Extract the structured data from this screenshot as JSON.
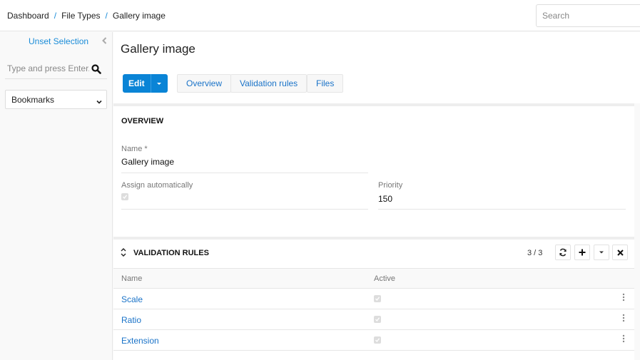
{
  "header": {
    "breadcrumb": [
      "Dashboard",
      "File Types",
      "Gallery image"
    ],
    "separator": "/",
    "search_placeholder": "Search"
  },
  "sidebar": {
    "unset_selection": "Unset Selection",
    "search_placeholder": "Type and press Enter...",
    "bookmarks_label": "Bookmarks"
  },
  "page": {
    "title": "Gallery image",
    "edit_label": "Edit",
    "tabs": [
      "Overview",
      "Validation rules",
      "Files"
    ]
  },
  "overview": {
    "title": "OVERVIEW",
    "name_label": "Name *",
    "name_value": "Gallery image",
    "assign_label": "Assign automatically",
    "assign_checked": true,
    "priority_label": "Priority",
    "priority_value": "150"
  },
  "validation_rules": {
    "title": "VALIDATION RULES",
    "count": "3 / 3",
    "columns": [
      "Name",
      "Active"
    ],
    "rows": [
      {
        "name": "Scale",
        "active": true
      },
      {
        "name": "Ratio",
        "active": true
      },
      {
        "name": "Extension",
        "active": true
      }
    ]
  },
  "colors": {
    "accent": "#0a84d6",
    "link": "#1a73c8"
  }
}
